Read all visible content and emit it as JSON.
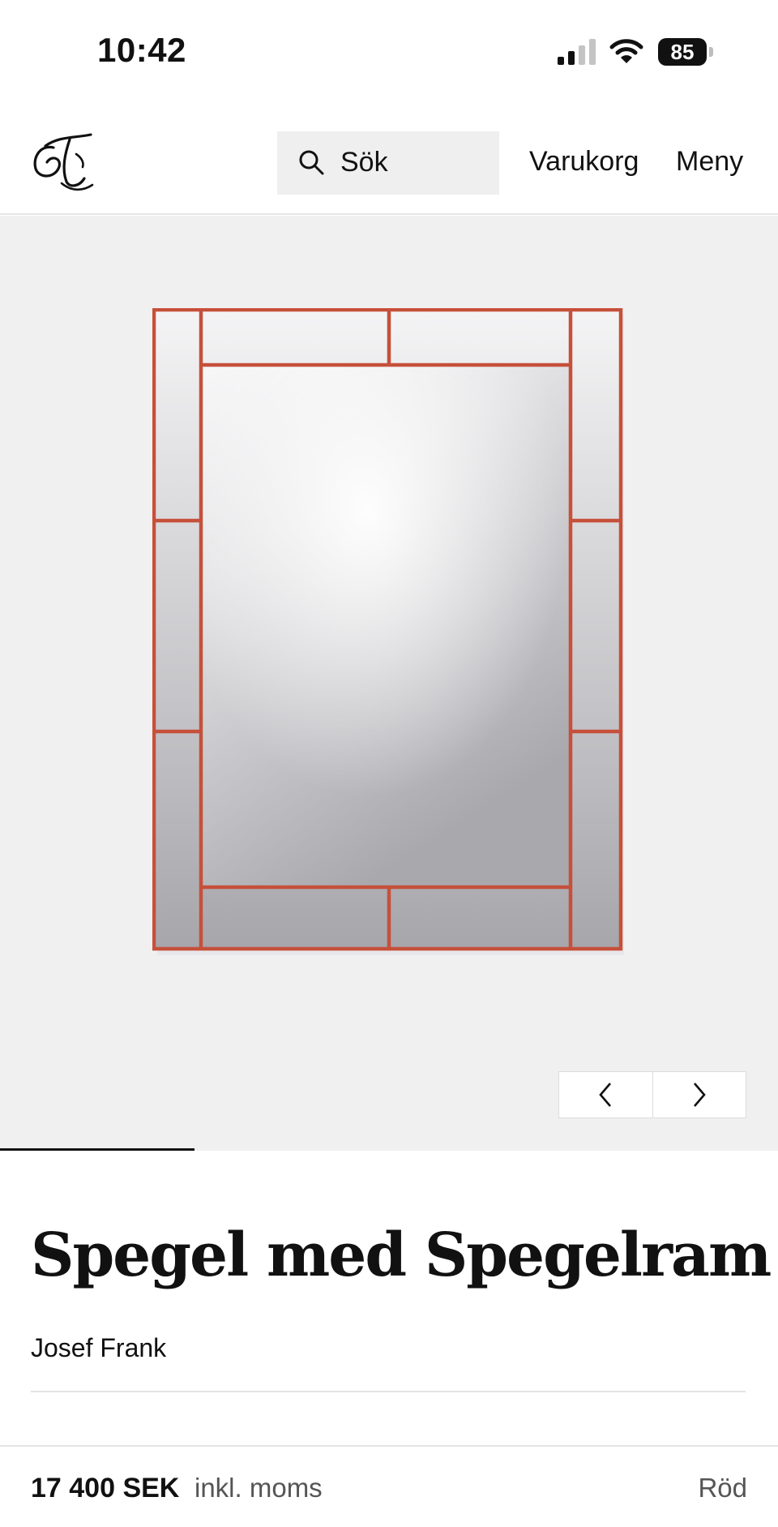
{
  "status_bar": {
    "time": "10:42",
    "battery_level": "85",
    "signal_bars_active": 2,
    "signal_bars_total": 4,
    "icons": [
      "signal-icon",
      "wifi-icon",
      "battery-icon"
    ]
  },
  "header": {
    "logo_icon": "monogram-logo-icon",
    "search_placeholder": "Sök",
    "cart_label": "Varukorg",
    "menu_label": "Meny"
  },
  "gallery": {
    "frame_color": "#c6503a",
    "background_color": "#f1f0f1",
    "prev_icon": "chevron-left-icon",
    "next_icon": "chevron-right-icon",
    "progress_fraction": 0.25
  },
  "product": {
    "title": "Spegel med Spegelram",
    "designer": "Josef Frank",
    "price": "17 400 SEK",
    "tax_note": "inkl. moms",
    "color": "Röd"
  }
}
